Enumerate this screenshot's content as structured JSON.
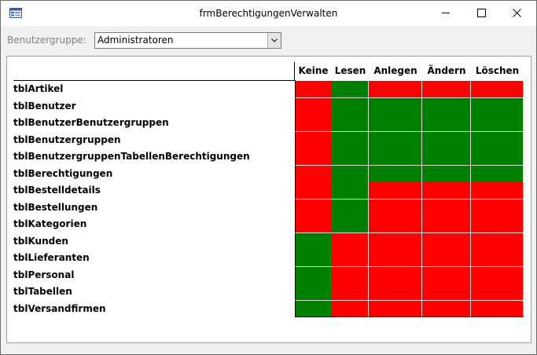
{
  "window": {
    "title": "frmBerechtigungenVerwalten"
  },
  "filter": {
    "label": "Benutzergruppe:",
    "selected": "Administratoren"
  },
  "colors": {
    "allowed": "#008000",
    "denied": "#ff0000"
  },
  "icons": {
    "app": "form-icon",
    "minimize": "minimize-icon",
    "maximize": "maximize-icon",
    "close": "close-icon",
    "dropdown": "chevron-down-icon"
  },
  "matrix": {
    "columns": [
      "Keine",
      "Lesen",
      "Anlegen",
      "Ändern",
      "Löschen"
    ],
    "rows": [
      {
        "table": "tblArtikel",
        "permissions": [
          0,
          1,
          0,
          0,
          0
        ]
      },
      {
        "table": "tblBenutzer",
        "permissions": [
          0,
          1,
          1,
          1,
          1
        ]
      },
      {
        "table": "tblBenutzerBenutzergruppen",
        "permissions": [
          0,
          1,
          1,
          1,
          1
        ]
      },
      {
        "table": "tblBenutzergruppen",
        "permissions": [
          0,
          1,
          1,
          1,
          1
        ]
      },
      {
        "table": "tblBenutzergruppenTabellenBerechtigungen",
        "permissions": [
          0,
          1,
          1,
          1,
          1
        ]
      },
      {
        "table": "tblBerechtigungen",
        "permissions": [
          0,
          1,
          1,
          1,
          1
        ]
      },
      {
        "table": "tblBestelldetails",
        "permissions": [
          0,
          1,
          0,
          0,
          0
        ]
      },
      {
        "table": "tblBestellungen",
        "permissions": [
          0,
          1,
          0,
          0,
          0
        ]
      },
      {
        "table": "tblKategorien",
        "permissions": [
          0,
          1,
          0,
          0,
          0
        ]
      },
      {
        "table": "tblKunden",
        "permissions": [
          1,
          0,
          0,
          0,
          0
        ]
      },
      {
        "table": "tblLieferanten",
        "permissions": [
          1,
          0,
          0,
          0,
          0
        ]
      },
      {
        "table": "tblPersonal",
        "permissions": [
          1,
          0,
          0,
          0,
          0
        ]
      },
      {
        "table": "tblTabellen",
        "permissions": [
          1,
          0,
          0,
          0,
          0
        ]
      },
      {
        "table": "tblVersandfirmen",
        "permissions": [
          1,
          0,
          0,
          0,
          0
        ]
      }
    ]
  }
}
